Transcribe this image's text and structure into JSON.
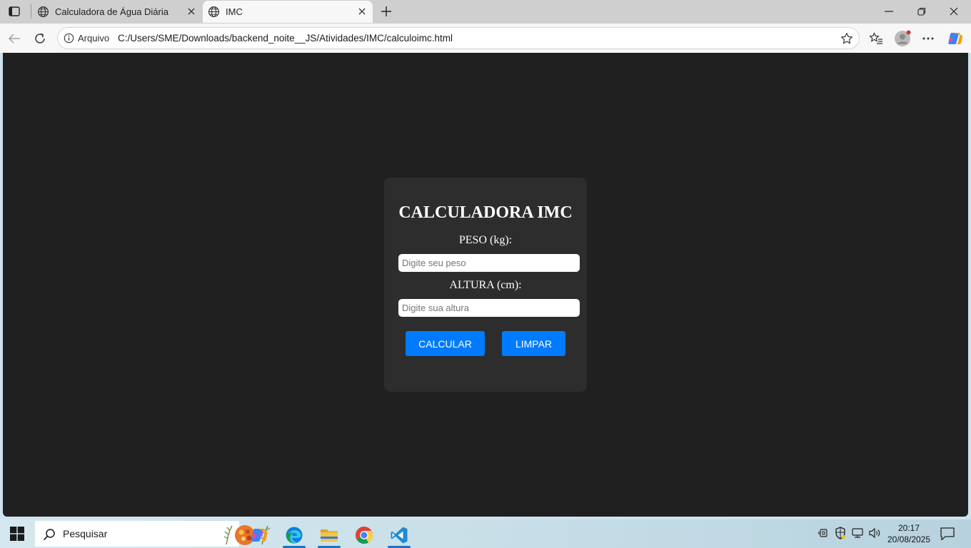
{
  "browser": {
    "tabs": [
      {
        "title": "Calculadora de Água Diária",
        "active": false
      },
      {
        "title": "IMC",
        "active": true
      }
    ],
    "address": {
      "scheme_label": "Arquivo",
      "url": "C:/Users/SME/Downloads/backend_noite__JS/Atividades/IMC/calculoimc.html"
    }
  },
  "page": {
    "title": "CALCULADORA IMC",
    "weight_label": "PESO (kg):",
    "weight_placeholder": "Digite seu peso",
    "height_label": "ALTURA (cm):",
    "height_placeholder": "Digite sua altura",
    "calculate_label": "CALCULAR",
    "clear_label": "LIMPAR",
    "colors": {
      "background": "#202020",
      "card": "#2d2d2d",
      "button": "#007bff"
    }
  },
  "taskbar": {
    "search_text": "Pesquisar",
    "time": "20:17",
    "date": "20/08/2025",
    "apps": [
      "copilot-icon",
      "edge-icon",
      "file-explorer-icon",
      "chrome-icon",
      "vscode-icon"
    ]
  }
}
